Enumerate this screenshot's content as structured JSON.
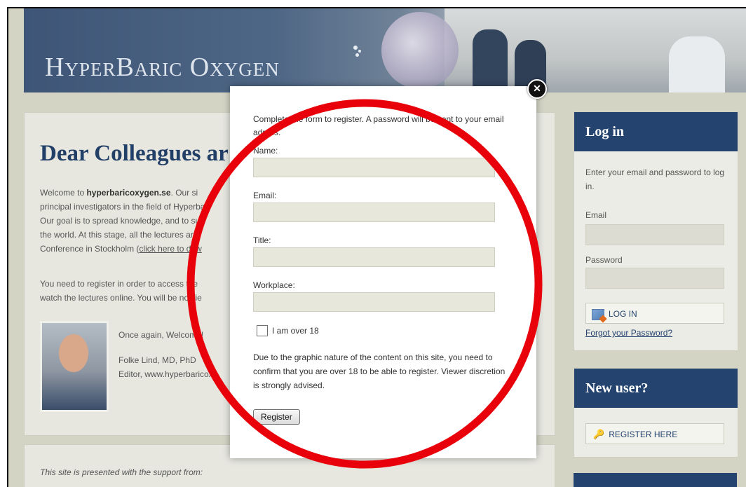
{
  "banner": {
    "logo_text": "HyperBaric Oxygen"
  },
  "main": {
    "heading": "Dear Colleagues ar",
    "p1": {
      "welcome_prefix": "Welcome to ",
      "site_name": "hyperbaricoxygen.se",
      "text_after_site": ". Our si",
      "line2": "principal investigators in the field of Hyperba",
      "line3": "Our goal is to spread knowledge, and to su",
      "line4": "the world. At this stage, all the lectures are",
      "line5_prefix": "Conference in Stockholm (",
      "line5_link": "click here to dow"
    },
    "p2": {
      "line1": "You need to register in order to access the",
      "line2": "watch the lectures online. You will be notifie"
    },
    "caption": {
      "welcome": "Once again, Welcome!",
      "name": "Folke Lind, MD, PhD",
      "editor": "Editor, www.hyperbaricox"
    }
  },
  "support": {
    "text": "This site is presented with the support from:"
  },
  "login": {
    "title": "Log in",
    "description": "Enter your email and password to log in.",
    "email_label": "Email",
    "password_label": "Password",
    "login_button": "LOG IN",
    "forgot_link": "Forgot your Password?"
  },
  "new_user": {
    "title": "New user?",
    "register_button": "REGISTER HERE"
  },
  "modal": {
    "intro": "Complete the form to register. A password will be sent to your email adress.",
    "name_label": "Name:",
    "email_label": "Email:",
    "title_label": "Title:",
    "workplace_label": "Workplace:",
    "checkbox_label": "I am over 18",
    "notice": "Due to the graphic nature of the content on this site, you need to confirm that you are over 18 to be able to register. Viewer discretion is strongly advised.",
    "register_button": "Register",
    "close_glyph": "✕"
  },
  "colors": {
    "navy": "#24436e",
    "annotation_red": "#e8000b"
  }
}
